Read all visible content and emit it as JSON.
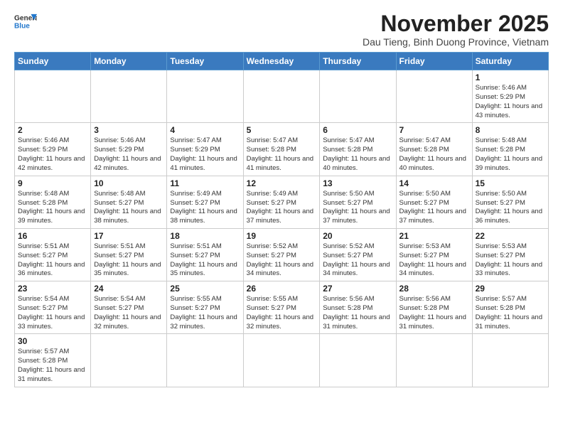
{
  "logo": {
    "line1": "General",
    "line2": "Blue"
  },
  "title": "November 2025",
  "location": "Dau Tieng, Binh Duong Province, Vietnam",
  "days_of_week": [
    "Sunday",
    "Monday",
    "Tuesday",
    "Wednesday",
    "Thursday",
    "Friday",
    "Saturday"
  ],
  "weeks": [
    [
      {
        "day": "",
        "info": ""
      },
      {
        "day": "",
        "info": ""
      },
      {
        "day": "",
        "info": ""
      },
      {
        "day": "",
        "info": ""
      },
      {
        "day": "",
        "info": ""
      },
      {
        "day": "",
        "info": ""
      },
      {
        "day": "1",
        "info": "Sunrise: 5:46 AM\nSunset: 5:29 PM\nDaylight: 11 hours and 43 minutes."
      }
    ],
    [
      {
        "day": "2",
        "info": "Sunrise: 5:46 AM\nSunset: 5:29 PM\nDaylight: 11 hours and 42 minutes."
      },
      {
        "day": "3",
        "info": "Sunrise: 5:46 AM\nSunset: 5:29 PM\nDaylight: 11 hours and 42 minutes."
      },
      {
        "day": "4",
        "info": "Sunrise: 5:47 AM\nSunset: 5:29 PM\nDaylight: 11 hours and 41 minutes."
      },
      {
        "day": "5",
        "info": "Sunrise: 5:47 AM\nSunset: 5:28 PM\nDaylight: 11 hours and 41 minutes."
      },
      {
        "day": "6",
        "info": "Sunrise: 5:47 AM\nSunset: 5:28 PM\nDaylight: 11 hours and 40 minutes."
      },
      {
        "day": "7",
        "info": "Sunrise: 5:47 AM\nSunset: 5:28 PM\nDaylight: 11 hours and 40 minutes."
      },
      {
        "day": "8",
        "info": "Sunrise: 5:48 AM\nSunset: 5:28 PM\nDaylight: 11 hours and 39 minutes."
      }
    ],
    [
      {
        "day": "9",
        "info": "Sunrise: 5:48 AM\nSunset: 5:28 PM\nDaylight: 11 hours and 39 minutes."
      },
      {
        "day": "10",
        "info": "Sunrise: 5:48 AM\nSunset: 5:27 PM\nDaylight: 11 hours and 38 minutes."
      },
      {
        "day": "11",
        "info": "Sunrise: 5:49 AM\nSunset: 5:27 PM\nDaylight: 11 hours and 38 minutes."
      },
      {
        "day": "12",
        "info": "Sunrise: 5:49 AM\nSunset: 5:27 PM\nDaylight: 11 hours and 37 minutes."
      },
      {
        "day": "13",
        "info": "Sunrise: 5:50 AM\nSunset: 5:27 PM\nDaylight: 11 hours and 37 minutes."
      },
      {
        "day": "14",
        "info": "Sunrise: 5:50 AM\nSunset: 5:27 PM\nDaylight: 11 hours and 37 minutes."
      },
      {
        "day": "15",
        "info": "Sunrise: 5:50 AM\nSunset: 5:27 PM\nDaylight: 11 hours and 36 minutes."
      }
    ],
    [
      {
        "day": "16",
        "info": "Sunrise: 5:51 AM\nSunset: 5:27 PM\nDaylight: 11 hours and 36 minutes."
      },
      {
        "day": "17",
        "info": "Sunrise: 5:51 AM\nSunset: 5:27 PM\nDaylight: 11 hours and 35 minutes."
      },
      {
        "day": "18",
        "info": "Sunrise: 5:51 AM\nSunset: 5:27 PM\nDaylight: 11 hours and 35 minutes."
      },
      {
        "day": "19",
        "info": "Sunrise: 5:52 AM\nSunset: 5:27 PM\nDaylight: 11 hours and 34 minutes."
      },
      {
        "day": "20",
        "info": "Sunrise: 5:52 AM\nSunset: 5:27 PM\nDaylight: 11 hours and 34 minutes."
      },
      {
        "day": "21",
        "info": "Sunrise: 5:53 AM\nSunset: 5:27 PM\nDaylight: 11 hours and 34 minutes."
      },
      {
        "day": "22",
        "info": "Sunrise: 5:53 AM\nSunset: 5:27 PM\nDaylight: 11 hours and 33 minutes."
      }
    ],
    [
      {
        "day": "23",
        "info": "Sunrise: 5:54 AM\nSunset: 5:27 PM\nDaylight: 11 hours and 33 minutes."
      },
      {
        "day": "24",
        "info": "Sunrise: 5:54 AM\nSunset: 5:27 PM\nDaylight: 11 hours and 32 minutes."
      },
      {
        "day": "25",
        "info": "Sunrise: 5:55 AM\nSunset: 5:27 PM\nDaylight: 11 hours and 32 minutes."
      },
      {
        "day": "26",
        "info": "Sunrise: 5:55 AM\nSunset: 5:27 PM\nDaylight: 11 hours and 32 minutes."
      },
      {
        "day": "27",
        "info": "Sunrise: 5:56 AM\nSunset: 5:28 PM\nDaylight: 11 hours and 31 minutes."
      },
      {
        "day": "28",
        "info": "Sunrise: 5:56 AM\nSunset: 5:28 PM\nDaylight: 11 hours and 31 minutes."
      },
      {
        "day": "29",
        "info": "Sunrise: 5:57 AM\nSunset: 5:28 PM\nDaylight: 11 hours and 31 minutes."
      }
    ],
    [
      {
        "day": "30",
        "info": "Sunrise: 5:57 AM\nSunset: 5:28 PM\nDaylight: 11 hours and 31 minutes."
      },
      {
        "day": "",
        "info": ""
      },
      {
        "day": "",
        "info": ""
      },
      {
        "day": "",
        "info": ""
      },
      {
        "day": "",
        "info": ""
      },
      {
        "day": "",
        "info": ""
      },
      {
        "day": "",
        "info": ""
      }
    ]
  ]
}
